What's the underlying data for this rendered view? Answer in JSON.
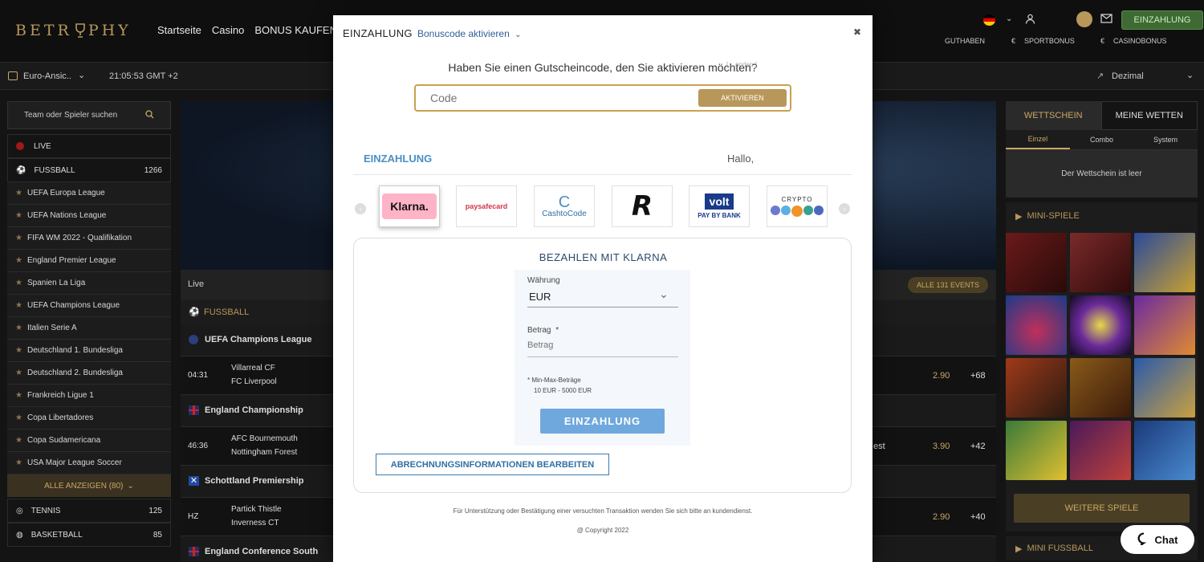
{
  "header": {
    "logo": "BETR",
    "logo_rest": "PHY",
    "nav": [
      "Startseite",
      "Casino",
      "BONUS KAUFEN"
    ],
    "deposit_label": "EINZAHLUNG",
    "guthaben": "GUTHABEN",
    "sportbonus": "SPORTBONUS",
    "casinobonus": "CASINOBONUS",
    "currency": "€"
  },
  "subbar": {
    "odds_view": "Euro-Ansic..",
    "time": "21:05:53 GMT +2",
    "odds_format": "Dezimal"
  },
  "sidebar": {
    "search_placeholder": "Team oder Spieler suchen",
    "live": "LIVE",
    "fussball": {
      "label": "FUSSBALL",
      "count": "1266"
    },
    "leagues": [
      "UEFA Europa League",
      "UEFA Nations League",
      "FIFA WM 2022 - Qualifikation",
      "England Premier League",
      "Spanien La Liga",
      "UEFA Champions League",
      "Italien Serie A",
      "Deutschland 1. Bundesliga",
      "Deutschland 2. Bundesliga",
      "Frankreich Ligue 1",
      "Copa Libertadores",
      "Copa Sudamericana",
      "USA Major League Soccer"
    ],
    "show_all": "ALLE ANZEIGEN (80)",
    "tennis": {
      "label": "TENNIS",
      "count": "125"
    },
    "basketball": {
      "label": "BASKETBALL",
      "count": "85"
    }
  },
  "main": {
    "live_label": "Live",
    "all_events": "ALLE 131 EVENTS",
    "sport": "FUSSBALL",
    "rows": [
      {
        "league": "UEFA Champions League"
      },
      {
        "time": "04:31",
        "home": "Villarreal CF",
        "away": "FC Liverpool",
        "odd": "2.90",
        "more": "+68"
      },
      {
        "league": "England Championship"
      },
      {
        "time": "46:36",
        "home": "AFC Bournemouth",
        "away": "Nottingham Forest",
        "partial": "est",
        "odd": "3.90",
        "more": "+42"
      },
      {
        "league": "Schottland Premiership"
      },
      {
        "time": "HZ",
        "home": "Partick Thistle",
        "away": "Inverness CT",
        "odd": "2.90",
        "more": "+40"
      },
      {
        "league": "England Conference South"
      }
    ]
  },
  "rightbar": {
    "tab_betslip": "WETTSCHEIN",
    "tab_mybets": "MEINE WETTEN",
    "subtabs": [
      "Einzel",
      "Combo",
      "System"
    ],
    "empty": "Der Wettschein ist leer",
    "minigames": "MINI-SPIELE",
    "more_games": "WEITERE SPIELE",
    "mini_football": "MINI FUSSBALL"
  },
  "modal": {
    "title": "EINZAHLUNG",
    "bonus_dropdown": "Bonuscode aktivieren",
    "question": "Haben Sie einen Gutscheincode, den Sie aktivieren möchten?",
    "faded_hint": "[ ...enden ]",
    "code_placeholder": "Code",
    "activate": "AKTIVIEREN",
    "section": "EINZAHLUNG",
    "hello": "Hallo,",
    "methods": [
      "Klarna.",
      "paysafecard",
      "CashtoCode",
      "Revolut",
      "volt",
      "CRYPTO"
    ],
    "volt_sub": "PAY BY BANK",
    "panel_title": "BEZAHLEN MIT KLARNA",
    "currency_label": "Währung",
    "currency_value": "EUR",
    "amount_label": "Betrag",
    "amount_required": "*",
    "amount_placeholder": "Betrag",
    "minmax_title": "* Min-Max-Beträge",
    "minmax_range": "10 EUR - 5000 EUR",
    "pay_button": "EINZAHLUNG",
    "billing_button": "ABRECHNUNGSINFORMATIONEN BEARBEITEN",
    "support": "Für Unterstützung oder Bestätigung einer versuchten Transaktion wenden Sie sich bitte an kundendienst.",
    "copyright": "@ Copyright 2022"
  },
  "chat": {
    "label": "Chat"
  },
  "colors": {
    "gold": "#b8975a",
    "blue_link": "#2e5f9a",
    "pay_button": "#6fa8dc",
    "klarna_pink": "#ffb3c7"
  }
}
